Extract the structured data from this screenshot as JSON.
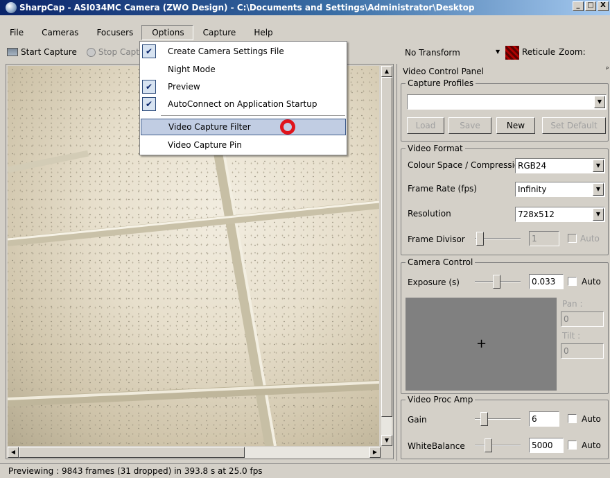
{
  "window": {
    "title": "SharpCap - ASI034MC Camera (ZWO Design) - C:\\Documents and Settings\\Administrator\\Desktop",
    "min_glyph": "_",
    "max_glyph": "□",
    "close_glyph": "X"
  },
  "menubar": {
    "items": [
      "File",
      "Cameras",
      "Focusers",
      "Options",
      "Capture",
      "Help"
    ]
  },
  "toolbar": {
    "start_capture": "Start Capture",
    "stop_capture": "Stop Captu"
  },
  "top_right": {
    "transform": "No Transform",
    "reticule": "Reticule",
    "zoom": "Zoom:"
  },
  "options_menu": {
    "items": [
      {
        "label": "Create Camera Settings File",
        "checked": true
      },
      {
        "label": "Night Mode",
        "checked": false
      },
      {
        "label": "Preview",
        "checked": true
      },
      {
        "label": "AutoConnect on Application Startup",
        "checked": true
      },
      {
        "label": "Video Capture Filter",
        "checked": false,
        "highlighted": true
      },
      {
        "label": "Video Capture Pin",
        "checked": false
      }
    ]
  },
  "panel": {
    "title": "Video Control Panel",
    "capture_profiles": {
      "title": "Capture Profiles",
      "selected": "",
      "load": "Load",
      "save": "Save",
      "new": "New",
      "set_default": "Set Default"
    },
    "video_format": {
      "title": "Video Format",
      "colour_space_label": "Colour Space / Compression",
      "colour_space_value": "RGB24",
      "frame_rate_label": "Frame Rate (fps)",
      "frame_rate_value": "Infinity",
      "resolution_label": "Resolution",
      "resolution_value": "728x512",
      "frame_divisor_label": "Frame Divisor",
      "frame_divisor_value": "1",
      "frame_divisor_auto": "Auto"
    },
    "camera_control": {
      "title": "Camera Control",
      "exposure_label": "Exposure (s)",
      "exposure_value": "0.033",
      "exposure_auto": "Auto",
      "pan_label": "Pan :",
      "pan_value": "0",
      "tilt_label": "Tilt :",
      "tilt_value": "0",
      "crosshair": "+"
    },
    "video_proc_amp": {
      "title": "Video Proc Amp",
      "gain_label": "Gain",
      "gain_value": "6",
      "gain_auto": "Auto",
      "wb_label": "WhiteBalance",
      "wb_value": "5000",
      "wb_auto": "Auto"
    }
  },
  "status": {
    "text": "Previewing : 9843 frames (31 dropped) in 393.8 s at 25.0 fps"
  },
  "colors": {
    "titlebar_start": "#0a246a",
    "titlebar_end": "#a6caf0",
    "menu_highlight": "#c1cde3",
    "cursor_marker": "#e0141c"
  }
}
